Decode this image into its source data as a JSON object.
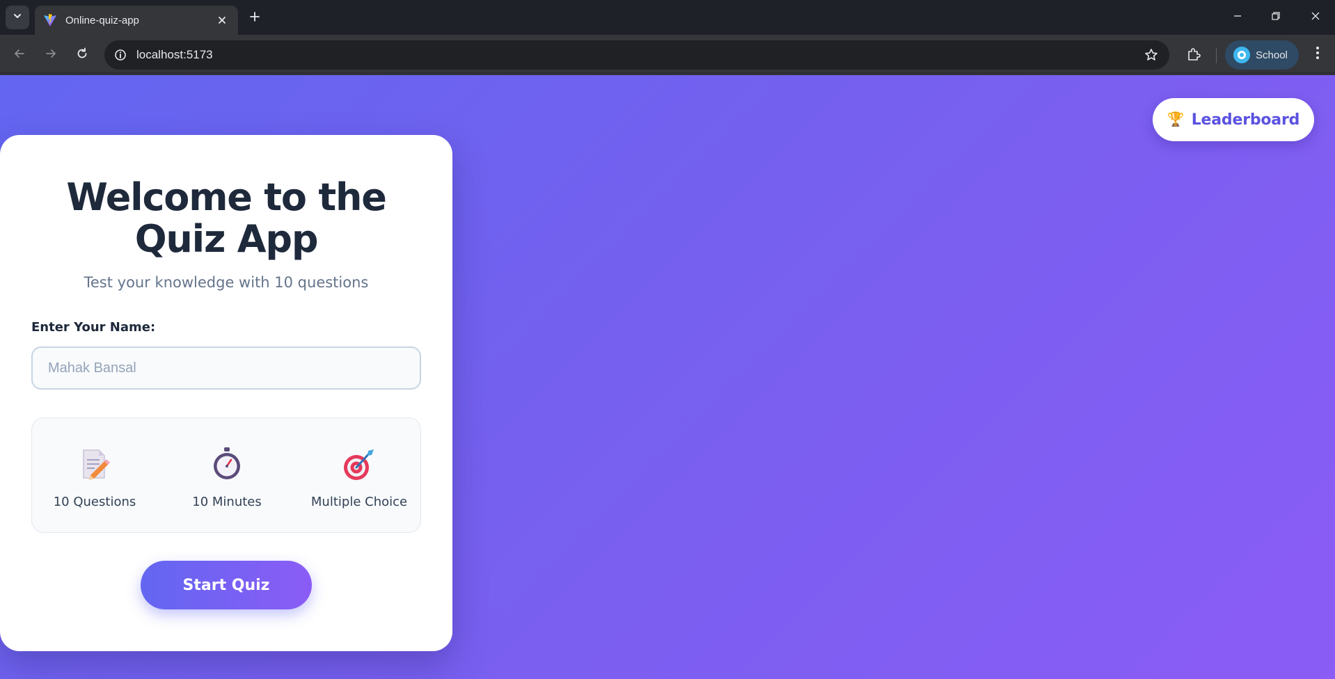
{
  "browser": {
    "tab_title": "Online-quiz-app",
    "url": "localhost:5173",
    "profile_label": "School"
  },
  "page": {
    "leaderboard_button": {
      "icon": "trophy-icon",
      "label": "Leaderboard"
    },
    "welcome_card": {
      "title": "Welcome to the Quiz App",
      "subtitle": "Test your knowledge with 10 questions",
      "name_label": "Enter Your Name:",
      "name_placeholder": "Mahak Bansal",
      "features": [
        {
          "icon": "memo-icon",
          "label": "10 Questions"
        },
        {
          "icon": "stopwatch-icon",
          "label": "10 Minutes"
        },
        {
          "icon": "target-icon",
          "label": "Multiple Choice"
        }
      ],
      "start_button_label": "Start Quiz"
    }
  },
  "colors": {
    "background_gradient_start": "#6366f1",
    "background_gradient_end": "#8b5cf6",
    "accent": "#5b52e0",
    "title_text": "#1e293b",
    "muted_text": "#64748b"
  }
}
